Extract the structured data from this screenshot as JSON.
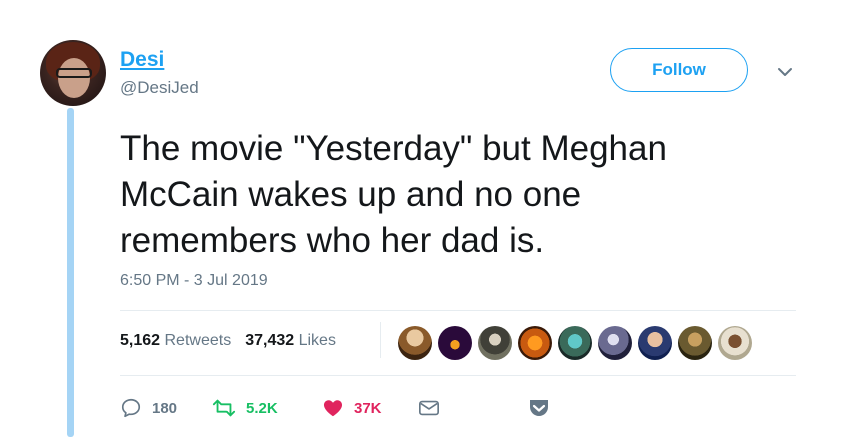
{
  "author": {
    "display_name": "Desi",
    "handle": "@DesiJed"
  },
  "follow_label": "Follow",
  "tweet": {
    "text": "The movie \"Yesterday\" but Meghan\nMcCain wakes up and no one\nremembers who her dad is.",
    "timestamp": "6:50 PM - 3 Jul 2019"
  },
  "stats": {
    "retweets_count": "5,162",
    "retweets_label": "Retweets",
    "likes_count": "37,432",
    "likes_label": "Likes"
  },
  "liker_avatars": 9,
  "actions": {
    "replies": "180",
    "retweets": "5.2K",
    "likes": "37K"
  },
  "colors": {
    "accent": "#1da1f2",
    "retweet": "#17bf63",
    "like": "#e0245e",
    "muted": "#657786",
    "thread_line": "#a5d4f5"
  }
}
